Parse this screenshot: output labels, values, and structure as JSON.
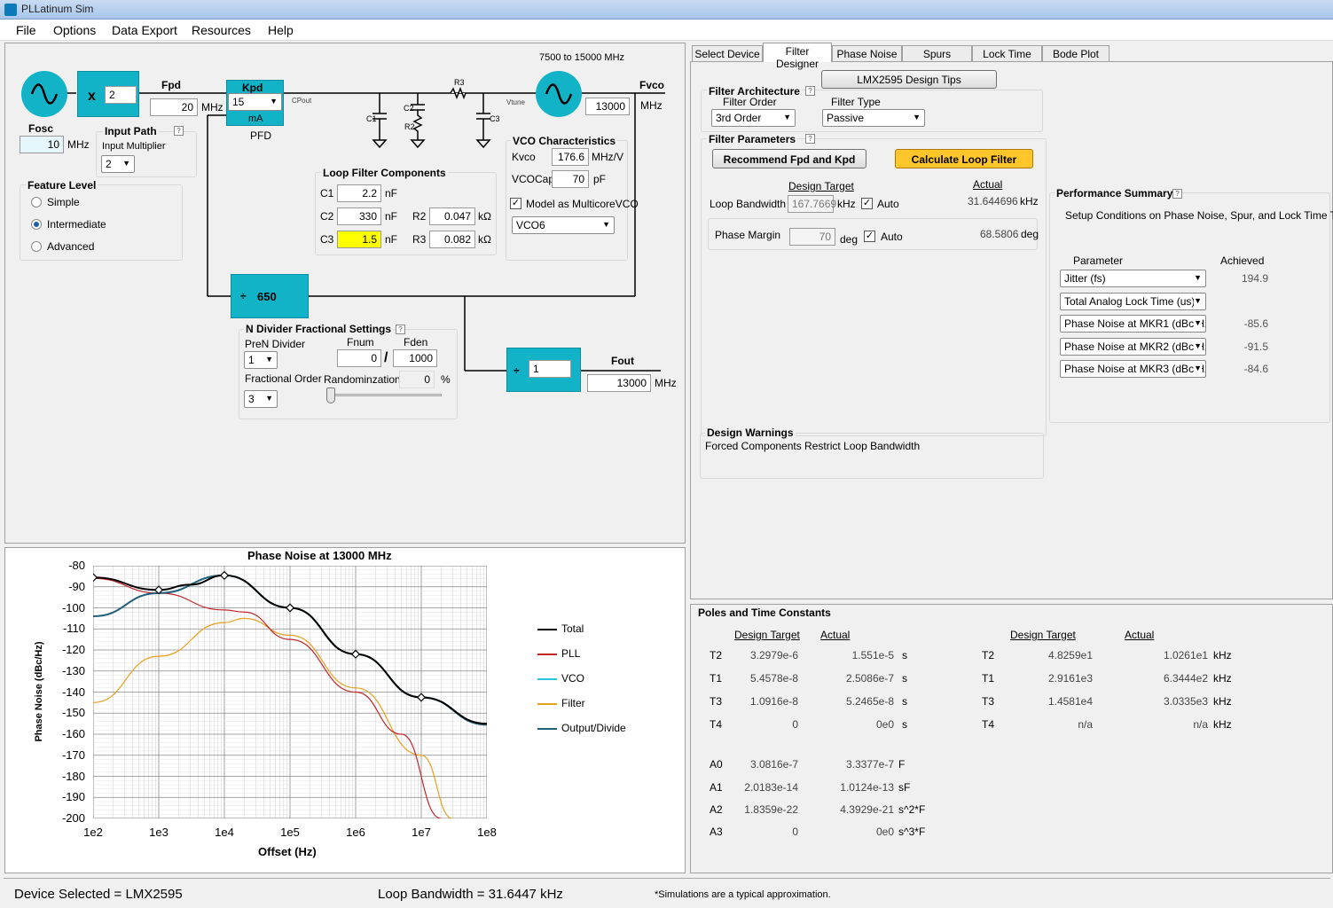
{
  "window": {
    "title": "PLLatinum Sim"
  },
  "menu": [
    "File",
    "Options",
    "Data Export",
    "Resources",
    "Help"
  ],
  "schematic": {
    "mult_symbol": "x",
    "mult_value": "2",
    "fpd_label": "Fpd",
    "fpd_value": "20",
    "fpd_unit": "MHz",
    "kpd_label": "Kpd",
    "kpd_value": "15",
    "kpd_unit": "mA",
    "pfd_label": "PFD",
    "cpout": "CPout",
    "r3": "R3",
    "c1": "C1",
    "c2": "C2",
    "r2": "R2",
    "c3": "C3",
    "vtune": "Vtune",
    "vco_range": "7500 to 15000 MHz",
    "fvco_label": "Fvco",
    "fvco_value": "13000",
    "fvco_unit": "MHz",
    "fosc_label": "Fosc",
    "fosc_value": "10",
    "fosc_unit": "MHz",
    "ndiv_symbol": "÷",
    "ndiv_value": "650",
    "outdiv_symbol": "÷",
    "outdiv_value": "1",
    "fout_label": "Fout",
    "fout_value": "13000",
    "fout_unit": "MHz"
  },
  "input_path": {
    "title": "Input Path",
    "mult_label": "Input Multiplier",
    "mult_value": "2"
  },
  "feature_level": {
    "title": "Feature Level",
    "options": [
      "Simple",
      "Intermediate",
      "Advanced"
    ],
    "selected": "Intermediate"
  },
  "loop_filter": {
    "title": "Loop Filter Components",
    "c1_label": "C1",
    "c1": "2.2",
    "c2_label": "C2",
    "c2": "330",
    "c3_label": "C3",
    "c3": "1.5",
    "cap_unit": "nF",
    "r2_label": "R2",
    "r2": "0.047",
    "r3_label": "R3",
    "r3": "0.082",
    "res_unit": "kΩ"
  },
  "vco_char": {
    "title": "VCO Characteristics",
    "kvco_label": "Kvco",
    "kvco": "176.6",
    "kvco_unit": "MHz/V",
    "vcocap_label": "VCOCap",
    "vcocap": "70",
    "vcocap_unit": "pF",
    "multicore_label": "Model as MulticoreVCO",
    "multicore_checked": true,
    "vco_select": "VCO6"
  },
  "ndiv_frac": {
    "title": "N Divider Fractional Settings",
    "pren_label": "PreN Divider",
    "pren": "1",
    "fnum_label": "Fnum",
    "fnum": "0",
    "fden_label": "Fden",
    "fden": "1000",
    "slash": "/",
    "order_label": "Fractional Order",
    "order": "3",
    "rand_label": "Randominzation",
    "rand": "0",
    "rand_unit": "%"
  },
  "plot": {
    "title": "Phase Noise at 13000 MHz",
    "xlabel": "Offset (Hz)",
    "ylabel": "Phase Noise (dBc/Hz)",
    "yticks": [
      "-80",
      "-90",
      "-100",
      "-110",
      "-120",
      "-130",
      "-140",
      "-150",
      "-160",
      "-170",
      "-180",
      "-190",
      "-200"
    ],
    "xticks": [
      "1e2",
      "1e3",
      "1e4",
      "1e5",
      "1e6",
      "1e7",
      "1e8"
    ],
    "legend": [
      {
        "name": "Total",
        "color": "#000000"
      },
      {
        "name": "PLL",
        "color": "#c0262a"
      },
      {
        "name": "VCO",
        "color": "#29c3e0"
      },
      {
        "name": "Filter",
        "color": "#e8a020"
      },
      {
        "name": "Output/Divide",
        "color": "#1f5f78"
      }
    ]
  },
  "chart_data": {
    "type": "line",
    "title": "Phase Noise at 13000 MHz",
    "xlabel": "Offset (Hz)",
    "ylabel": "Phase Noise (dBc/Hz)",
    "xscale": "log",
    "xlim": [
      100,
      100000000
    ],
    "ylim": [
      -200,
      -80
    ],
    "grid": true,
    "legend_position": "right",
    "series": [
      {
        "name": "Total",
        "x": [
          100,
          1000,
          3000,
          10000,
          100000,
          1000000,
          10000000,
          100000000
        ],
        "y": [
          -85.6,
          -91.5,
          -89,
          -84.6,
          -100,
          -122,
          -142.5,
          -155
        ]
      },
      {
        "name": "PLL",
        "x": [
          100,
          1000,
          10000,
          20000,
          100000,
          1000000,
          5000000,
          20000000
        ],
        "y": [
          -86,
          -93,
          -101,
          -102,
          -115,
          -140,
          -160,
          -200
        ]
      },
      {
        "name": "VCO",
        "x": [
          100,
          1000,
          10000,
          100000,
          1000000,
          10000000,
          100000000
        ],
        "y": [
          -104,
          -93,
          -84.6,
          -100,
          -122,
          -142.5,
          -155
        ]
      },
      {
        "name": "Filter",
        "x": [
          100,
          1000,
          10000,
          20000,
          100000,
          1000000,
          10000000,
          30000000
        ],
        "y": [
          -145,
          -123,
          -107,
          -105,
          -113,
          -138,
          -170,
          -200
        ]
      },
      {
        "name": "Output/Divide",
        "x": [
          100,
          1000,
          10000,
          100000,
          1000000,
          10000000,
          100000000
        ],
        "y": [
          -104,
          -93,
          -84.6,
          -100,
          -122,
          -142.5,
          -155.5
        ]
      }
    ],
    "markers": {
      "x": [
        100,
        1000,
        10000,
        100000,
        1000000,
        10000000
      ],
      "y": [
        -85.6,
        -91.5,
        -84.6,
        -100,
        -122,
        -142.5
      ]
    }
  },
  "tabs": [
    "Select Device",
    "Filter Designer",
    "Phase Noise",
    "Spurs",
    "Lock Time",
    "Bode Plot"
  ],
  "active_tab": "Filter Designer",
  "filter_designer": {
    "tips_button": "LMX2595 Design Tips",
    "arch_title": "Filter Architecture",
    "order_label": "Filter Order",
    "order": "3rd Order",
    "type_label": "Filter Type",
    "type": "Passive",
    "params_title": "Filter Parameters",
    "recommend_button": "Recommend Fpd and Kpd",
    "calc_button": "Calculate Loop Filter",
    "design_target": "Design Target",
    "actual": "Actual",
    "lbw_label": "Loop Bandwidth",
    "lbw_target": "167.7669",
    "lbw_unit": "kHz",
    "lbw_auto": "Auto",
    "lbw_actual": "31.644696",
    "lbw_actual_unit": "kHz",
    "pm_label": "Phase Margin",
    "pm_target": "70",
    "pm_unit": "deg",
    "pm_auto": "Auto",
    "pm_actual": "68.5806",
    "pm_actual_unit": "deg",
    "warn_title": "Design Warnings",
    "warn_text": "Forced Components Restrict Loop Bandwidth"
  },
  "performance": {
    "title": "Performance Summary",
    "subtitle": "Setup Conditions on Phase Noise, Spur, and Lock Time Tabs",
    "param_header": "Parameter",
    "achieved_header": "Achieved",
    "rows": [
      {
        "param": "Jitter (fs)",
        "value": "194.9"
      },
      {
        "param": "Total Analog Lock Time (us)",
        "value": ""
      },
      {
        "param": "Phase Noise at MKR1 (dBc/Hz)",
        "value": "-85.6"
      },
      {
        "param": "Phase Noise at MKR2 (dBc/Hz)",
        "value": "-91.5"
      },
      {
        "param": "Phase Noise at MKR3 (dBc/Hz)",
        "value": "-84.6"
      }
    ]
  },
  "poles": {
    "title": "Poles and Time Constants",
    "design_target": "Design Target",
    "actual": "Actual",
    "left": [
      {
        "name": "T2",
        "target": "3.2979e-6",
        "actual": "1.551e-5",
        "unit": "s"
      },
      {
        "name": "T1",
        "target": "5.4578e-8",
        "actual": "2.5086e-7",
        "unit": "s"
      },
      {
        "name": "T3",
        "target": "1.0916e-8",
        "actual": "5.2465e-8",
        "unit": "s"
      },
      {
        "name": "T4",
        "target": "0",
        "actual": "0e0",
        "unit": "s"
      }
    ],
    "right": [
      {
        "name": "T2",
        "target": "4.8259e1",
        "actual": "1.0261e1",
        "unit": "kHz"
      },
      {
        "name": "T1",
        "target": "2.9161e3",
        "actual": "6.3444e2",
        "unit": "kHz"
      },
      {
        "name": "T3",
        "target": "1.4581e4",
        "actual": "3.0335e3",
        "unit": "kHz"
      },
      {
        "name": "T4",
        "target": "n/a",
        "actual": "n/a",
        "unit": "kHz"
      }
    ],
    "a": [
      {
        "name": "A0",
        "target": "3.0816e-7",
        "actual": "3.3377e-7",
        "unit": "F"
      },
      {
        "name": "A1",
        "target": "2.0183e-14",
        "actual": "1.0124e-13",
        "unit": "sF"
      },
      {
        "name": "A2",
        "target": "1.8359e-22",
        "actual": "4.3929e-21",
        "unit": "s^2*F"
      },
      {
        "name": "A3",
        "target": "0",
        "actual": "0e0",
        "unit": "s^3*F"
      }
    ]
  },
  "status": {
    "device": "Device Selected = LMX2595",
    "lbw": "Loop Bandwidth = 31.6447 kHz",
    "note": "*Simulations are a typical approximation."
  },
  "colors": {
    "teal": "#12b3c7",
    "highlight": "#ffff00",
    "calc_button": "#ffc62b"
  }
}
